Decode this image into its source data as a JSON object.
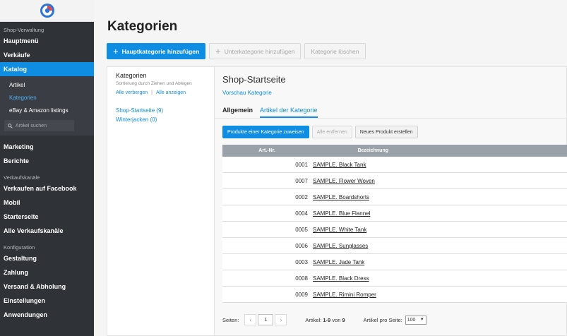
{
  "sidebar": {
    "sections": {
      "shop": "Shop-Verwaltung",
      "channels": "Verkaufskanäle",
      "config": "Konfiguration"
    },
    "items": {
      "hauptmenu": "Hauptmenü",
      "verkaeufe": "Verkäufe",
      "katalog": "Katalog",
      "artikel": "Artikel",
      "kategorien": "Kategorien",
      "ebay": "eBay & Amazon listings",
      "marketing": "Marketing",
      "berichte": "Berichte",
      "facebook": "Verkaufen auf Facebook",
      "mobil": "Mobil",
      "starterseite": "Starterseite",
      "alle_kanaele": "Alle Verkaufskanäle",
      "gestaltung": "Gestaltung",
      "zahlung": "Zahlung",
      "versand": "Versand & Abholung",
      "einstellungen": "Einstellungen",
      "anwendungen": "Anwendungen"
    },
    "search_placeholder": "Artikel suchen"
  },
  "page": {
    "title": "Kategorien",
    "toolbar": {
      "add_main": "Hauptkategorie hinzufügen",
      "add_sub": "Unterkategorie hinzufügen",
      "delete": "Kategorie löschen"
    }
  },
  "left_panel": {
    "title": "Kategorien",
    "hint": "Sortierung durch Ziehen und Ablegen",
    "hide_all": "Alle verbergen",
    "separator": "|",
    "show_all": "Alle anzeigen",
    "categories": [
      "Shop-Startseite (9)",
      "Winterjacken (0)"
    ]
  },
  "right_panel": {
    "title": "Shop-Startseite",
    "preview": "Vorschau Kategorie",
    "tabs": [
      "Allgemein",
      "Artikel der Kategorie"
    ],
    "actions": {
      "assign": "Produkte einer Kategorie zuweisen",
      "remove": "Alle entfernen",
      "create": "Neues Produkt erstellen"
    },
    "table": {
      "headers": {
        "nr": "Art.-Nr.",
        "bez": "Bezeichnung"
      },
      "rows": [
        {
          "nr": "0001",
          "bez": "SAMPLE. Black Tank"
        },
        {
          "nr": "0007",
          "bez": "SAMPLE. Flower Woven"
        },
        {
          "nr": "0002",
          "bez": "SAMPLE. Boardshorts"
        },
        {
          "nr": "0004",
          "bez": "SAMPLE. Blue Flannel"
        },
        {
          "nr": "0005",
          "bez": "SAMPLE. White Tank"
        },
        {
          "nr": "0006",
          "bez": "SAMPLE. Sunglasses"
        },
        {
          "nr": "0003",
          "bez": "SAMPLE. Jade Tank"
        },
        {
          "nr": "0008",
          "bez": "SAMPLE. Black Dress"
        },
        {
          "nr": "0009",
          "bez": "SAMPLE. Rimini Romper"
        }
      ]
    },
    "pager": {
      "label": "Seiten:",
      "prev": "‹",
      "page": "1",
      "next": "›",
      "count_prefix": "Artikel:",
      "count_range": "1-9",
      "count_of": "von",
      "count_total": "9",
      "perpage_label": "Artikel pro Seite:",
      "perpage_value": "100"
    }
  },
  "colors": {
    "accent": "#0f8de3",
    "sidebar": "#2f3237",
    "table_header": "#9aa1a9"
  }
}
